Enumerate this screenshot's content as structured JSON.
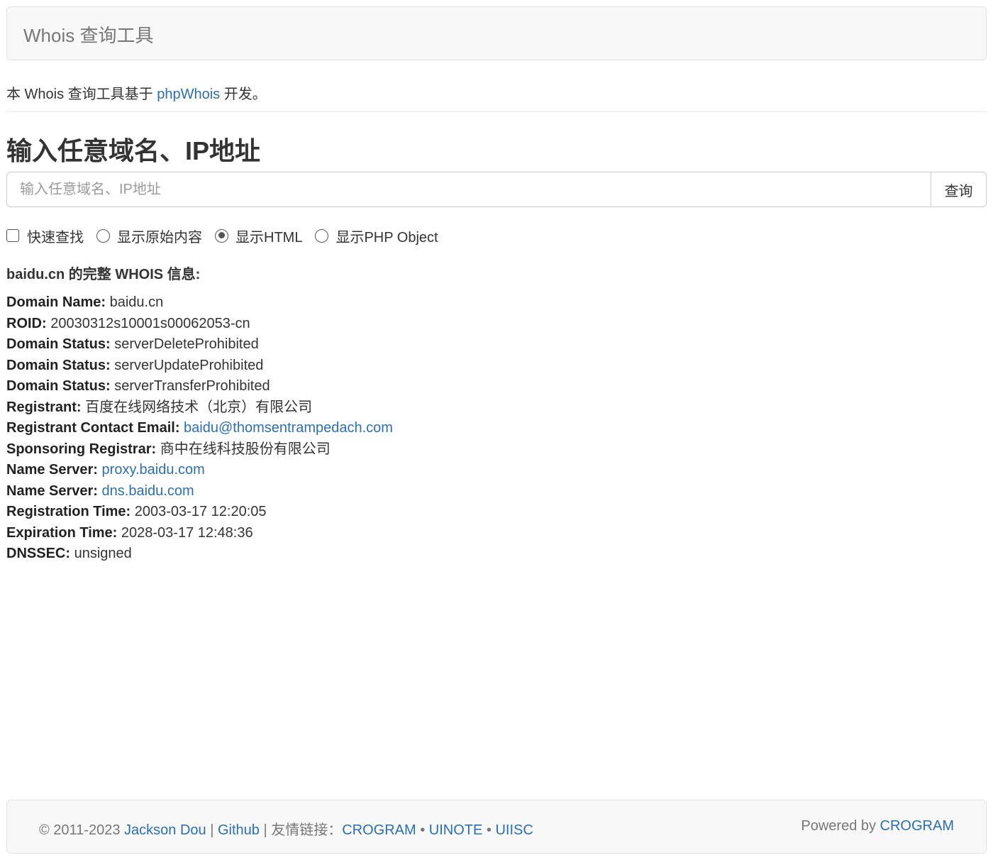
{
  "navbar": {
    "brand": "Whois 查询工具"
  },
  "intro": {
    "prefix": "本 Whois 查询工具基于 ",
    "link": "phpWhois",
    "suffix": " 开发。"
  },
  "heading": "输入任意域名、IP地址",
  "search": {
    "placeholder": "输入任意域名、IP地址",
    "value": "",
    "button": "查询"
  },
  "options": [
    {
      "type": "checkbox",
      "label": "快速查找",
      "checked": false
    },
    {
      "type": "radio",
      "label": "显示原始内容",
      "checked": false
    },
    {
      "type": "radio",
      "label": "显示HTML",
      "checked": true
    },
    {
      "type": "radio",
      "label": "显示PHP Object",
      "checked": false
    }
  ],
  "result": {
    "title": "baidu.cn 的完整 WHOIS 信息:",
    "rows": [
      {
        "label": "Domain Name:",
        "value": "baidu.cn",
        "link": false
      },
      {
        "label": "ROID:",
        "value": "20030312s10001s00062053-cn",
        "link": false
      },
      {
        "label": "Domain Status:",
        "value": "serverDeleteProhibited",
        "link": false
      },
      {
        "label": "Domain Status:",
        "value": "serverUpdateProhibited",
        "link": false
      },
      {
        "label": "Domain Status:",
        "value": "serverTransferProhibited",
        "link": false
      },
      {
        "label": "Registrant:",
        "value": "百度在线网络技术（北京）有限公司",
        "link": false
      },
      {
        "label": "Registrant Contact Email:",
        "value": "baidu@thomsentrampedach.com",
        "link": true
      },
      {
        "label": "Sponsoring Registrar:",
        "value": "商中在线科技股份有限公司",
        "link": false
      },
      {
        "label": "Name Server:",
        "value": "proxy.baidu.com",
        "link": true
      },
      {
        "label": "Name Server:",
        "value": "dns.baidu.com",
        "link": true
      },
      {
        "label": "Registration Time:",
        "value": "2003-03-17 12:20:05",
        "link": false
      },
      {
        "label": "Expiration Time:",
        "value": "2028-03-17 12:48:36",
        "link": false
      },
      {
        "label": "DNSSEC:",
        "value": "unsigned",
        "link": false
      }
    ]
  },
  "footer": {
    "copyright": "© 2011-2023 ",
    "author_link": "Jackson Dou",
    "sep1": " | ",
    "github_link": "Github",
    "sep2": " | 友情链接：",
    "friend_links": [
      "CROGRAM",
      "UINOTE",
      "UIISC"
    ],
    "bullet": " • ",
    "powered_prefix": "Powered by ",
    "powered_link": "CROGRAM"
  },
  "colors": {
    "link": "#2a6fb0",
    "text": "#333333",
    "muted": "#777777",
    "panel_bg": "#f8f8f8"
  }
}
